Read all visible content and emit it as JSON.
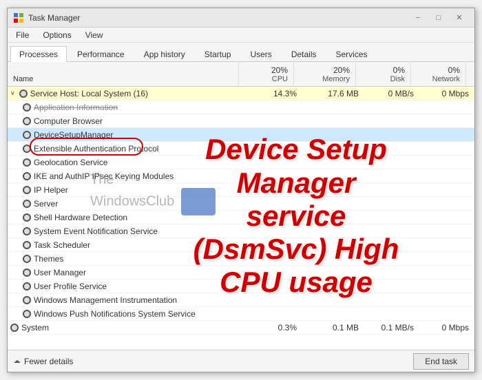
{
  "window": {
    "title": "Task Manager",
    "controls": {
      "minimize": "−",
      "maximize": "□",
      "close": "✕"
    }
  },
  "menu": {
    "items": [
      "File",
      "Options",
      "View"
    ]
  },
  "tabs": [
    {
      "id": "processes",
      "label": "Processes",
      "active": true
    },
    {
      "id": "performance",
      "label": "Performance"
    },
    {
      "id": "app-history",
      "label": "App history"
    },
    {
      "id": "startup",
      "label": "Startup"
    },
    {
      "id": "users",
      "label": "Users"
    },
    {
      "id": "details",
      "label": "Details"
    },
    {
      "id": "services",
      "label": "Services"
    }
  ],
  "columns": {
    "name": "Name",
    "cpu": {
      "pct": "20%",
      "label": "CPU"
    },
    "memory": {
      "pct": "20%",
      "label": "Memory"
    },
    "disk": {
      "pct": "0%",
      "label": "Disk"
    },
    "network": {
      "pct": "0%",
      "label": "Network"
    }
  },
  "rows": [
    {
      "type": "parent",
      "name": "Service Host: Local System (16)",
      "cpu": "14.3%",
      "memory": "17.6 MB",
      "disk": "0 MB/s",
      "network": "0 Mbps",
      "highlighted": true,
      "indent": 1
    },
    {
      "type": "child",
      "name": "Application Information",
      "cpu": "",
      "memory": "",
      "disk": "",
      "network": "",
      "strikethrough": true,
      "indent": 2
    },
    {
      "type": "child",
      "name": "Computer Browser",
      "cpu": "",
      "memory": "",
      "disk": "",
      "network": "",
      "indent": 2
    },
    {
      "type": "child",
      "name": "DeviceSetupManager",
      "cpu": "",
      "memory": "",
      "disk": "",
      "network": "",
      "selected": true,
      "indent": 2
    },
    {
      "type": "child",
      "name": "Extensible Authentication Protocol",
      "cpu": "",
      "memory": "",
      "disk": "",
      "network": "",
      "indent": 2
    },
    {
      "type": "child",
      "name": "Geolocation Service",
      "cpu": "",
      "memory": "",
      "disk": "",
      "network": "",
      "indent": 2
    },
    {
      "type": "child",
      "name": "IKE and AuthIP IPsec Keying Modules",
      "cpu": "",
      "memory": "",
      "disk": "",
      "network": "",
      "indent": 2
    },
    {
      "type": "child",
      "name": "IP Helper",
      "cpu": "",
      "memory": "",
      "disk": "",
      "network": "",
      "indent": 2
    },
    {
      "type": "child",
      "name": "Server",
      "cpu": "",
      "memory": "",
      "disk": "",
      "network": "",
      "indent": 2
    },
    {
      "type": "child",
      "name": "Shell Hardware Detection",
      "cpu": "",
      "memory": "",
      "disk": "",
      "network": "",
      "indent": 2
    },
    {
      "type": "child",
      "name": "System Event Notification Service",
      "cpu": "",
      "memory": "",
      "disk": "",
      "network": "",
      "indent": 2
    },
    {
      "type": "child",
      "name": "Task Scheduler",
      "cpu": "",
      "memory": "",
      "disk": "",
      "network": "",
      "indent": 2
    },
    {
      "type": "child",
      "name": "Themes",
      "cpu": "",
      "memory": "",
      "disk": "",
      "network": "",
      "indent": 2
    },
    {
      "type": "child",
      "name": "User Manager",
      "cpu": "",
      "memory": "",
      "disk": "",
      "network": "",
      "indent": 2
    },
    {
      "type": "child",
      "name": "User Profile Service",
      "cpu": "",
      "memory": "",
      "disk": "",
      "network": "",
      "indent": 2
    },
    {
      "type": "child",
      "name": "Windows Management Instrumentation",
      "cpu": "",
      "memory": "",
      "disk": "",
      "network": "",
      "indent": 2
    },
    {
      "type": "child",
      "name": "Windows Push Notifications System Service",
      "cpu": "",
      "memory": "",
      "disk": "",
      "network": "",
      "indent": 2
    },
    {
      "type": "process",
      "name": "System",
      "cpu": "0.3%",
      "memory": "0.1 MB",
      "disk": "0.1 MB/s",
      "network": "0 Mbps",
      "indent": 1
    }
  ],
  "overlay": {
    "text": "Device Setup\nManager\nservice\n(DsmSvc) High\nCPU usage"
  },
  "watermark": {
    "text": "The\nWindowsClub"
  },
  "statusBar": {
    "fewerDetails": "Fewer details",
    "endTask": "End task"
  }
}
